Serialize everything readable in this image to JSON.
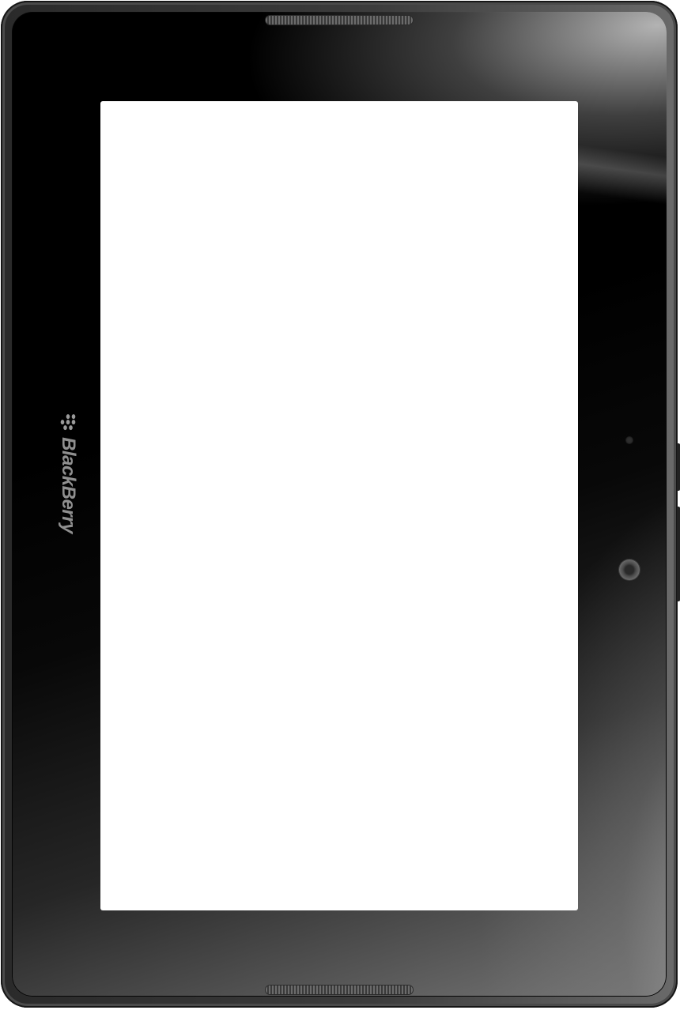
{
  "device": {
    "brand_name": "BlackBerry",
    "logo_icon": "blackberry-logo-icon",
    "colors": {
      "bezel": "#000000",
      "frame": "#3c3c3c",
      "screen": "#ffffff",
      "brand_text": "#8f8f8f"
    }
  }
}
